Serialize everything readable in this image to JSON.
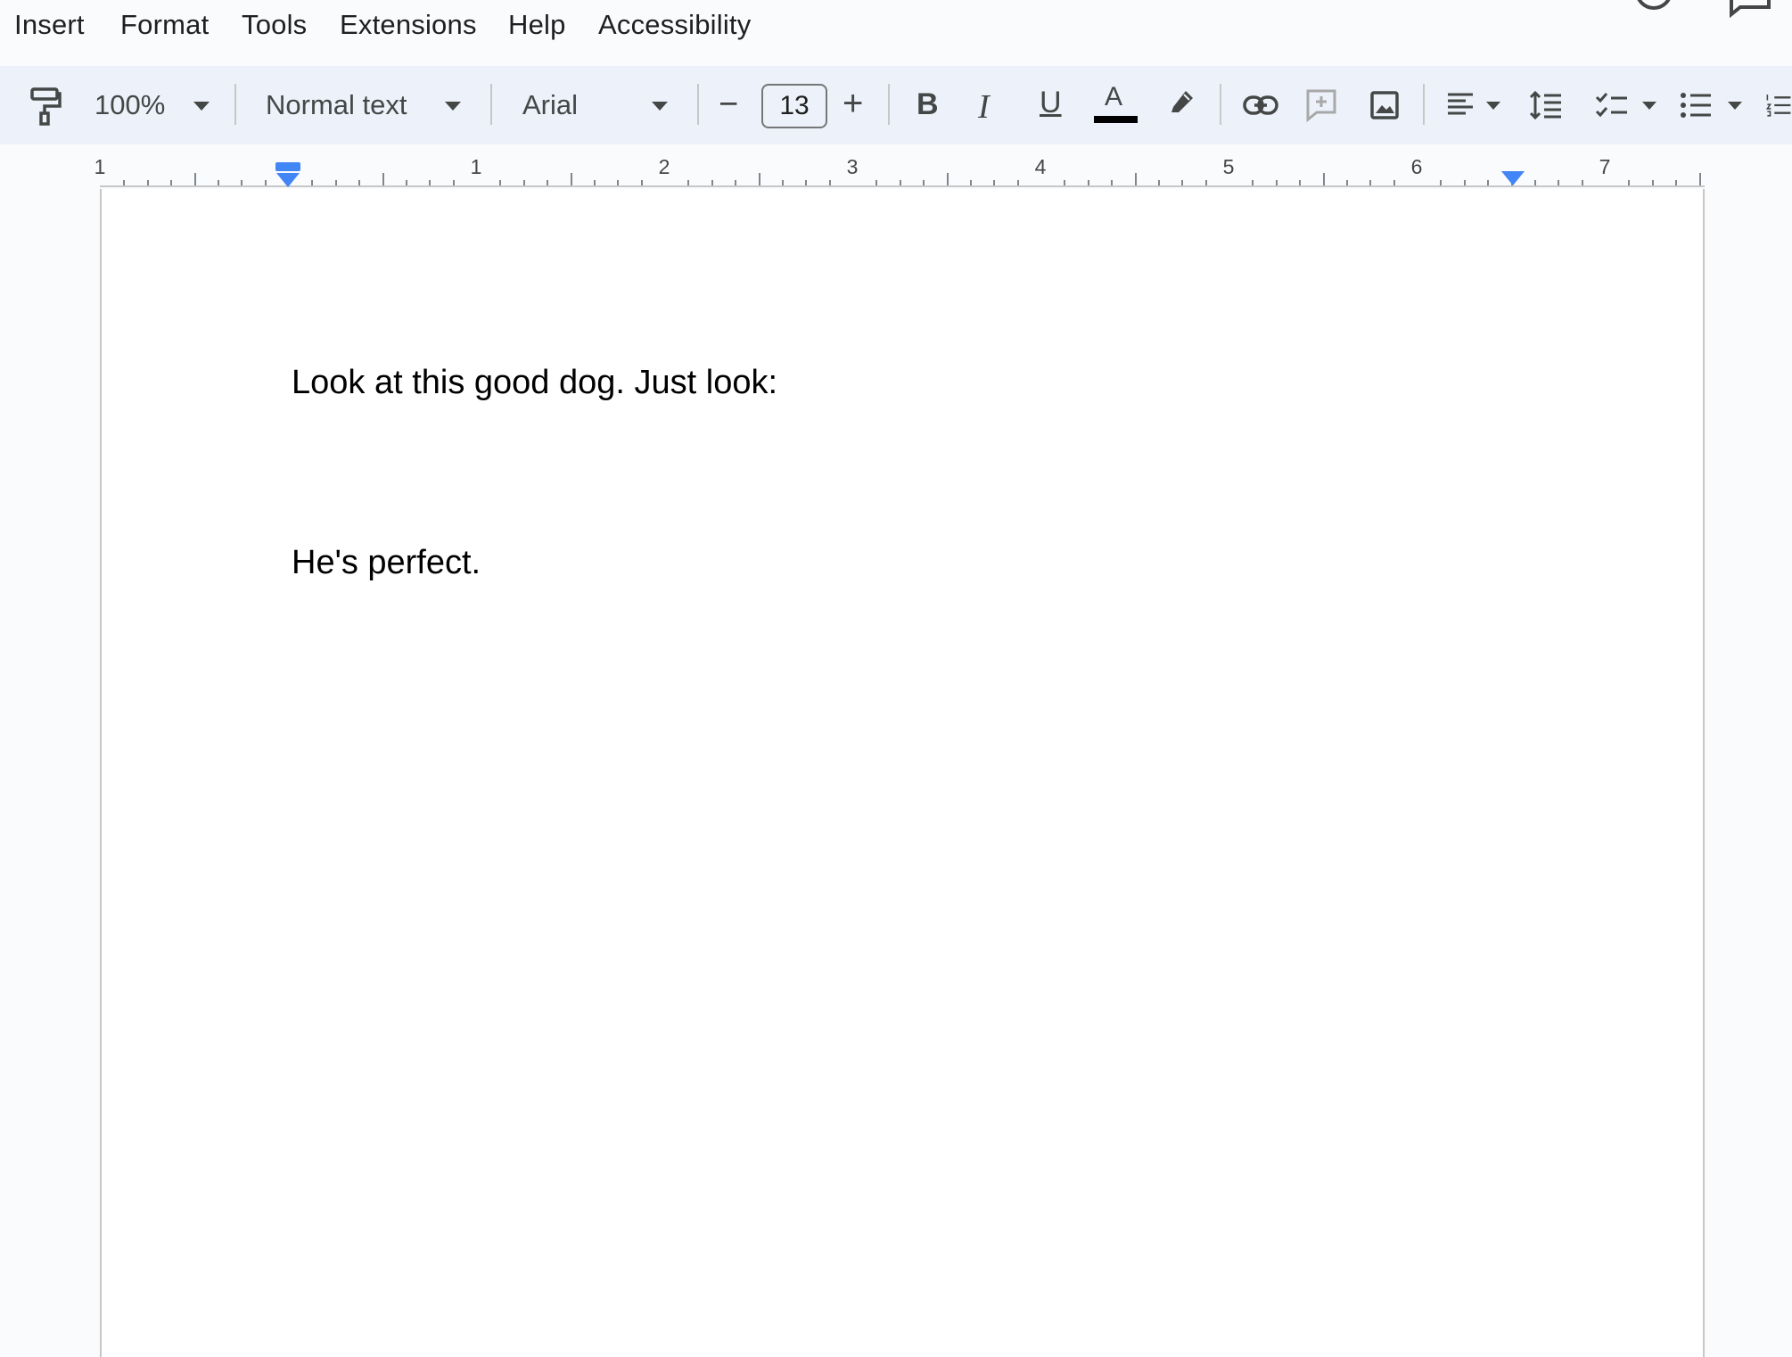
{
  "menu": {
    "items": [
      "Insert",
      "Format",
      "Tools",
      "Extensions",
      "Help",
      "Accessibility"
    ]
  },
  "toolbar": {
    "zoom": "100%",
    "style": "Normal text",
    "font": "Arial",
    "font_size": "13",
    "decrease_label": "−",
    "increase_label": "+",
    "bold_label": "B",
    "italic_label": "I",
    "underline_label": "U",
    "text_color_label": "A",
    "text_color": "#000000"
  },
  "ruler": {
    "labels": [
      "1",
      "1",
      "2",
      "3",
      "4",
      "5",
      "6",
      "7"
    ]
  },
  "document": {
    "paragraphs": [
      "Look at this good dog. Just look:",
      "He's perfect."
    ]
  },
  "colors": {
    "accent": "#4285f4",
    "toolbar_bg": "#edf2fa",
    "page_bg": "#ffffff"
  }
}
